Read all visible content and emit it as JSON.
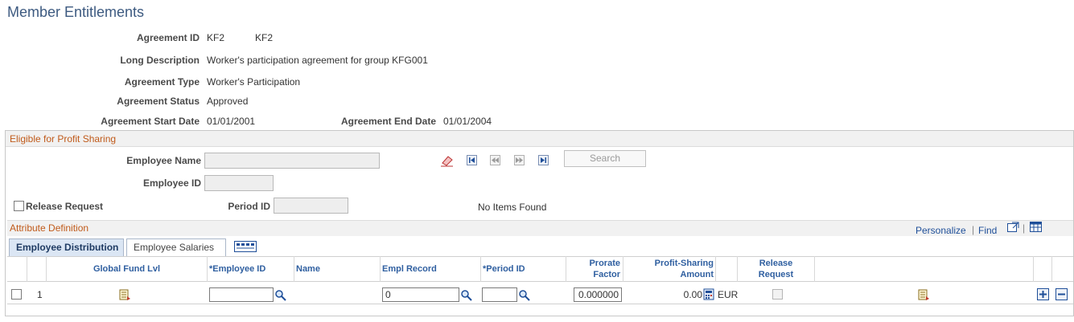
{
  "page_title": "Member Entitlements",
  "agreement": {
    "id_label": "Agreement ID",
    "id_value": "KF2",
    "id_value2": "KF2",
    "long_desc_label": "Long Description",
    "long_desc_value": "Worker's participation agreement for group KFG001",
    "type_label": "Agreement Type",
    "type_value": "Worker's Participation",
    "status_label": "Agreement Status",
    "status_value": "Approved",
    "start_label": "Agreement Start Date",
    "start_value": "01/01/2001",
    "end_label": "Agreement End Date",
    "end_value": "01/01/2004"
  },
  "eligible": {
    "title": "Eligible for Profit Sharing",
    "employee_name_label": "Employee Name",
    "employee_name_value": "",
    "employee_id_label": "Employee ID",
    "employee_id_value": "",
    "release_request_label": "Release Request",
    "period_id_label": "Period ID",
    "period_id_value": "",
    "search_label": "Search",
    "no_items": "No Items Found"
  },
  "attribute": {
    "title": "Attribute Definition",
    "personalize": "Personalize",
    "separator": "|",
    "find": "Find",
    "tabs": [
      {
        "label": "Employee Distribution",
        "active": true
      },
      {
        "label": "Employee Salaries",
        "active": false
      }
    ],
    "columns": {
      "global_fund": "Global Fund Lvl",
      "employee_id": "*Employee ID",
      "name": "Name",
      "empl_record": "Empl Record",
      "period_id": "*Period ID",
      "prorate_1": "Prorate",
      "prorate_2": "Factor",
      "profit_1": "Profit-Sharing",
      "profit_2": "Amount",
      "release_1": "Release",
      "release_2": "Request"
    },
    "row": {
      "number": "1",
      "employee_id": "",
      "empl_record": "0",
      "period_id": "",
      "prorate_factor": "0.000000",
      "profit_amount": "0.00",
      "currency": "EUR"
    }
  },
  "colors": {
    "title": "#3d5a80",
    "group_title": "#c05a1a",
    "column_header": "#2f5fa0",
    "link": "#1f4f99"
  }
}
